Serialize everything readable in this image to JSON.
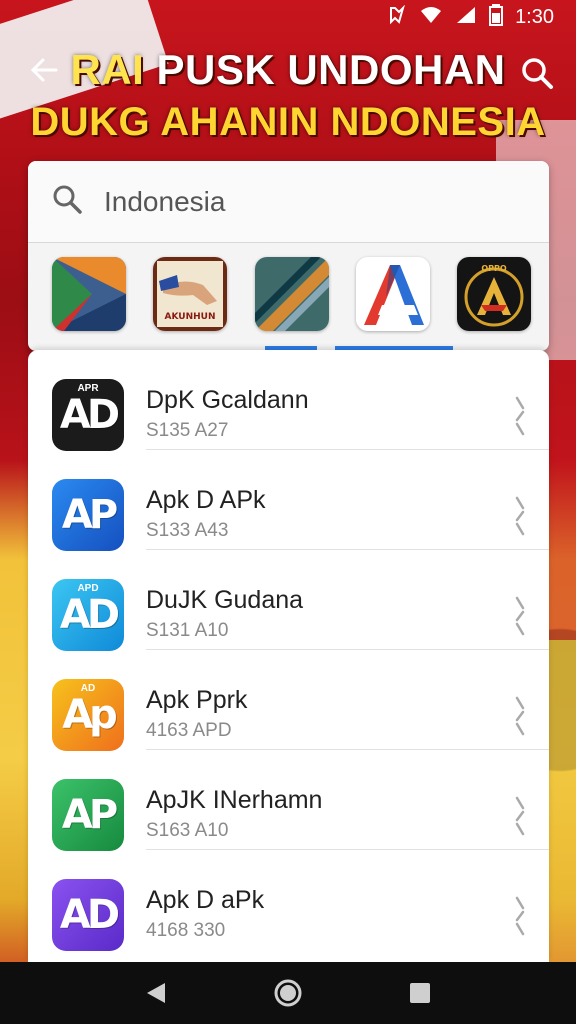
{
  "status_bar": {
    "time": "1:30",
    "icons": [
      "nfc-icon",
      "wifi-icon",
      "signal-icon",
      "battery-icon"
    ]
  },
  "header": {
    "title_line1_part1": "RAI ",
    "title_line1_part2": "PUSK UNDOHAN",
    "title_line2": "DUKG AHANIN NDONESIA",
    "back_icon": "back-arrow-icon",
    "search_icon": "search-icon"
  },
  "search": {
    "value": "Indonesia",
    "icon": "search-icon"
  },
  "featured_apps": [
    {
      "icon": "play-store-like-icon"
    },
    {
      "icon": "hand-logo-icon",
      "caption": "AKUNHUN"
    },
    {
      "icon": "diagonal-stripe-icon"
    },
    {
      "icon": "letter-a-icon"
    },
    {
      "icon": "emblem-a-icon",
      "caption": "OPPO"
    }
  ],
  "list": [
    {
      "name": "DpK Gcaldann",
      "sub": "S135 A27",
      "logo_text": "AD",
      "logo_small": "APR",
      "color": "#1b1b1b"
    },
    {
      "name": "Apk D APk",
      "sub": "S133 A43",
      "logo_text": "AP",
      "logo_small": "",
      "color": "#1f6fdc"
    },
    {
      "name": "DuJK Gudana",
      "sub": "S131 A10",
      "logo_text": "AD",
      "logo_small": "APD",
      "color": "#15a6e6"
    },
    {
      "name": "Apk Pprk",
      "sub": "4163 APD",
      "logo_text": "Ap",
      "logo_small": "AD",
      "color": "#f19a1a"
    },
    {
      "name": "ApJK INerhamn",
      "sub": "S163 A10",
      "logo_text": "AP",
      "logo_small": "",
      "color": "#1f9e49"
    },
    {
      "name": "Apk D aPk",
      "sub": "4168 330",
      "logo_text": "AD",
      "logo_small": "",
      "color": "#6b3cd6"
    }
  ],
  "navbar": {
    "back": "nav-back-icon",
    "home": "nav-home-icon",
    "recents": "nav-recents-icon"
  }
}
